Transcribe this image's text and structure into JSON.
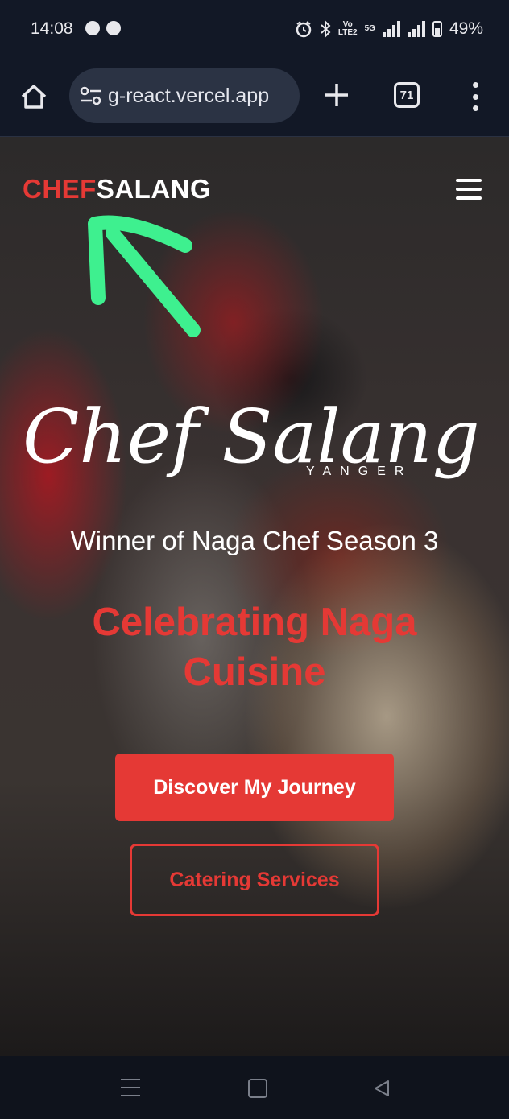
{
  "status_bar": {
    "time": "14:08",
    "carrier_tag_top": "Vo",
    "carrier_tag_bottom": "LTE2",
    "network_tag": "5G",
    "battery": "49%",
    "icons": [
      "chat-bubble-icon",
      "app-notification-icon",
      "alarm-icon",
      "bluetooth-icon",
      "signal-icon",
      "battery-icon"
    ]
  },
  "browser": {
    "url": "g-react.vercel.app",
    "tab_count": "71",
    "icons": [
      "home-icon",
      "site-settings-icon",
      "new-tab-icon",
      "tab-switcher-icon",
      "more-menu-icon"
    ]
  },
  "site": {
    "logo_part1": "CHEF",
    "logo_part2": "SALANG",
    "script_name": "Chef Salang",
    "script_sub": "YANGER",
    "subtitle": "Winner of Naga Chef Season 3",
    "headline": "Celebrating Naga Cuisine",
    "primary_button": "Discover My Journey",
    "secondary_button": "Catering Services",
    "colors": {
      "accent": "#e53935",
      "annotation": "#3ef08f"
    }
  }
}
